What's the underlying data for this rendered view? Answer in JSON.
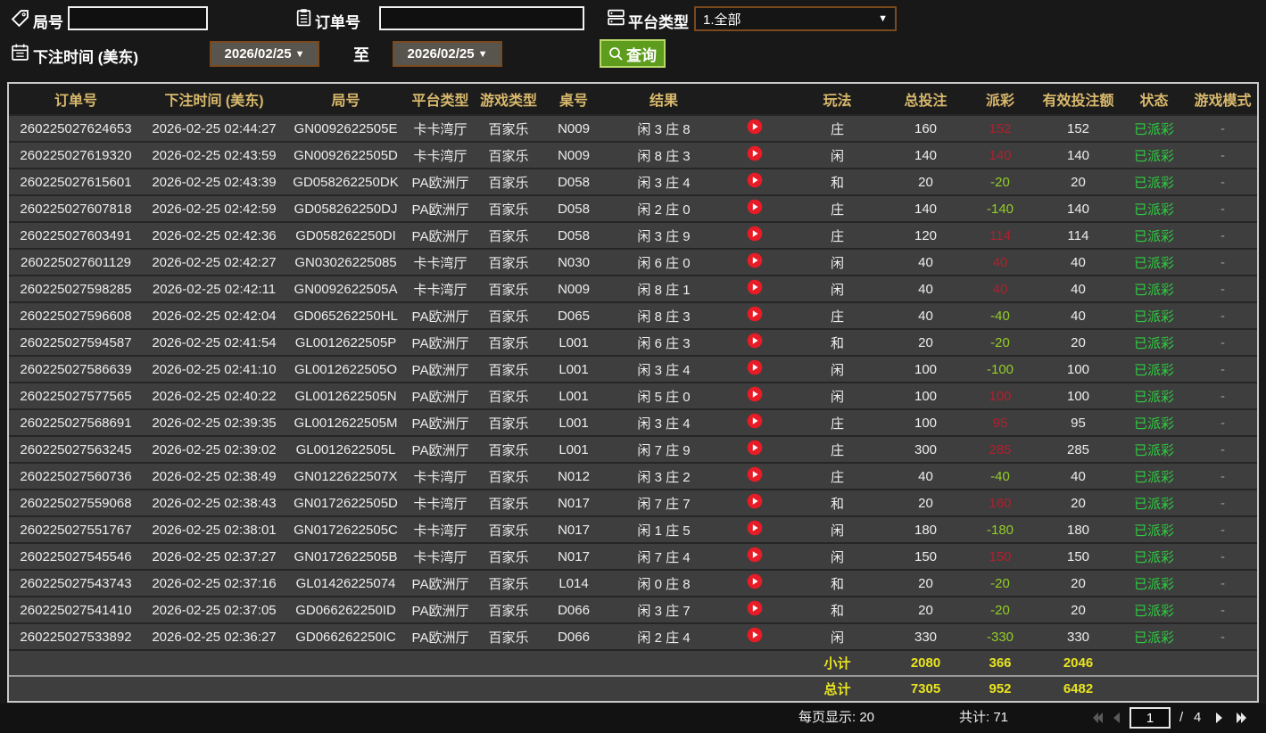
{
  "filters": {
    "round_label": "局号",
    "order_label": "订单号",
    "platform_label": "平台类型",
    "platform_value": "1.全部",
    "bet_time_label": "下注时间 (美东)",
    "date_from": "2026/02/25",
    "date_to": "2026/02/25",
    "to_label": "至",
    "query_label": "查询",
    "round_value": "",
    "order_value": ""
  },
  "table": {
    "headers": [
      "订单号",
      "下注时间 (美东)",
      "局号",
      "平台类型",
      "游戏类型",
      "桌号",
      "结果",
      "",
      "玩法",
      "总投注",
      "派彩",
      "有效投注额",
      "状态",
      "游戏模式"
    ],
    "rows": [
      {
        "order": "260225027624653",
        "time": "2026-02-25 02:44:27",
        "round": "GN0092622505E",
        "platform": "卡卡湾厅",
        "game": "百家乐",
        "table": "N009",
        "result": "闲 3 庄 8",
        "play": "庄",
        "total": "160",
        "payout": "152",
        "sign": "pos",
        "valid": "152",
        "status": "已派彩",
        "mode": "-"
      },
      {
        "order": "260225027619320",
        "time": "2026-02-25 02:43:59",
        "round": "GN0092622505D",
        "platform": "卡卡湾厅",
        "game": "百家乐",
        "table": "N009",
        "result": "闲 8 庄 3",
        "play": "闲",
        "total": "140",
        "payout": "140",
        "sign": "pos",
        "valid": "140",
        "status": "已派彩",
        "mode": "-"
      },
      {
        "order": "260225027615601",
        "time": "2026-02-25 02:43:39",
        "round": "GD058262250DK",
        "platform": "PA欧洲厅",
        "game": "百家乐",
        "table": "D058",
        "result": "闲 3 庄 4",
        "play": "和",
        "total": "20",
        "payout": "-20",
        "sign": "neg",
        "valid": "20",
        "status": "已派彩",
        "mode": "-"
      },
      {
        "order": "260225027607818",
        "time": "2026-02-25 02:42:59",
        "round": "GD058262250DJ",
        "platform": "PA欧洲厅",
        "game": "百家乐",
        "table": "D058",
        "result": "闲 2 庄 0",
        "play": "庄",
        "total": "140",
        "payout": "-140",
        "sign": "neg",
        "valid": "140",
        "status": "已派彩",
        "mode": "-"
      },
      {
        "order": "260225027603491",
        "time": "2026-02-25 02:42:36",
        "round": "GD058262250DI",
        "platform": "PA欧洲厅",
        "game": "百家乐",
        "table": "D058",
        "result": "闲 3 庄 9",
        "play": "庄",
        "total": "120",
        "payout": "114",
        "sign": "pos",
        "valid": "114",
        "status": "已派彩",
        "mode": "-"
      },
      {
        "order": "260225027601129",
        "time": "2026-02-25 02:42:27",
        "round": "GN03026225085",
        "platform": "卡卡湾厅",
        "game": "百家乐",
        "table": "N030",
        "result": "闲 6 庄 0",
        "play": "闲",
        "total": "40",
        "payout": "40",
        "sign": "pos",
        "valid": "40",
        "status": "已派彩",
        "mode": "-"
      },
      {
        "order": "260225027598285",
        "time": "2026-02-25 02:42:11",
        "round": "GN0092622505A",
        "platform": "卡卡湾厅",
        "game": "百家乐",
        "table": "N009",
        "result": "闲 8 庄 1",
        "play": "闲",
        "total": "40",
        "payout": "40",
        "sign": "pos",
        "valid": "40",
        "status": "已派彩",
        "mode": "-"
      },
      {
        "order": "260225027596608",
        "time": "2026-02-25 02:42:04",
        "round": "GD065262250HL",
        "platform": "PA欧洲厅",
        "game": "百家乐",
        "table": "D065",
        "result": "闲 8 庄 3",
        "play": "庄",
        "total": "40",
        "payout": "-40",
        "sign": "neg",
        "valid": "40",
        "status": "已派彩",
        "mode": "-"
      },
      {
        "order": "260225027594587",
        "time": "2026-02-25 02:41:54",
        "round": "GL0012622505P",
        "platform": "PA欧洲厅",
        "game": "百家乐",
        "table": "L001",
        "result": "闲 6 庄 3",
        "play": "和",
        "total": "20",
        "payout": "-20",
        "sign": "neg",
        "valid": "20",
        "status": "已派彩",
        "mode": "-"
      },
      {
        "order": "260225027586639",
        "time": "2026-02-25 02:41:10",
        "round": "GL0012622505O",
        "platform": "PA欧洲厅",
        "game": "百家乐",
        "table": "L001",
        "result": "闲 3 庄 4",
        "play": "闲",
        "total": "100",
        "payout": "-100",
        "sign": "neg",
        "valid": "100",
        "status": "已派彩",
        "mode": "-"
      },
      {
        "order": "260225027577565",
        "time": "2026-02-25 02:40:22",
        "round": "GL0012622505N",
        "platform": "PA欧洲厅",
        "game": "百家乐",
        "table": "L001",
        "result": "闲 5 庄 0",
        "play": "闲",
        "total": "100",
        "payout": "100",
        "sign": "pos",
        "valid": "100",
        "status": "已派彩",
        "mode": "-"
      },
      {
        "order": "260225027568691",
        "time": "2026-02-25 02:39:35",
        "round": "GL0012622505M",
        "platform": "PA欧洲厅",
        "game": "百家乐",
        "table": "L001",
        "result": "闲 3 庄 4",
        "play": "庄",
        "total": "100",
        "payout": "95",
        "sign": "pos",
        "valid": "95",
        "status": "已派彩",
        "mode": "-"
      },
      {
        "order": "260225027563245",
        "time": "2026-02-25 02:39:02",
        "round": "GL0012622505L",
        "platform": "PA欧洲厅",
        "game": "百家乐",
        "table": "L001",
        "result": "闲 7 庄 9",
        "play": "庄",
        "total": "300",
        "payout": "285",
        "sign": "pos",
        "valid": "285",
        "status": "已派彩",
        "mode": "-"
      },
      {
        "order": "260225027560736",
        "time": "2026-02-25 02:38:49",
        "round": "GN0122622507X",
        "platform": "卡卡湾厅",
        "game": "百家乐",
        "table": "N012",
        "result": "闲 3 庄 2",
        "play": "庄",
        "total": "40",
        "payout": "-40",
        "sign": "neg",
        "valid": "40",
        "status": "已派彩",
        "mode": "-"
      },
      {
        "order": "260225027559068",
        "time": "2026-02-25 02:38:43",
        "round": "GN0172622505D",
        "platform": "卡卡湾厅",
        "game": "百家乐",
        "table": "N017",
        "result": "闲 7 庄 7",
        "play": "和",
        "total": "20",
        "payout": "160",
        "sign": "pos",
        "valid": "20",
        "status": "已派彩",
        "mode": "-"
      },
      {
        "order": "260225027551767",
        "time": "2026-02-25 02:38:01",
        "round": "GN0172622505C",
        "platform": "卡卡湾厅",
        "game": "百家乐",
        "table": "N017",
        "result": "闲 1 庄 5",
        "play": "闲",
        "total": "180",
        "payout": "-180",
        "sign": "neg",
        "valid": "180",
        "status": "已派彩",
        "mode": "-"
      },
      {
        "order": "260225027545546",
        "time": "2026-02-25 02:37:27",
        "round": "GN0172622505B",
        "platform": "卡卡湾厅",
        "game": "百家乐",
        "table": "N017",
        "result": "闲 7 庄 4",
        "play": "闲",
        "total": "150",
        "payout": "150",
        "sign": "pos",
        "valid": "150",
        "status": "已派彩",
        "mode": "-"
      },
      {
        "order": "260225027543743",
        "time": "2026-02-25 02:37:16",
        "round": "GL01426225074",
        "platform": "PA欧洲厅",
        "game": "百家乐",
        "table": "L014",
        "result": "闲 0 庄 8",
        "play": "和",
        "total": "20",
        "payout": "-20",
        "sign": "neg",
        "valid": "20",
        "status": "已派彩",
        "mode": "-"
      },
      {
        "order": "260225027541410",
        "time": "2026-02-25 02:37:05",
        "round": "GD066262250ID",
        "platform": "PA欧洲厅",
        "game": "百家乐",
        "table": "D066",
        "result": "闲 3 庄 7",
        "play": "和",
        "total": "20",
        "payout": "-20",
        "sign": "neg",
        "valid": "20",
        "status": "已派彩",
        "mode": "-"
      },
      {
        "order": "260225027533892",
        "time": "2026-02-25 02:36:27",
        "round": "GD066262250IC",
        "platform": "PA欧洲厅",
        "game": "百家乐",
        "table": "D066",
        "result": "闲 2 庄 4",
        "play": "闲",
        "total": "330",
        "payout": "-330",
        "sign": "neg",
        "valid": "330",
        "status": "已派彩",
        "mode": "-"
      }
    ],
    "subtotal": {
      "label": "小计",
      "total": "2080",
      "payout": "366",
      "valid": "2046"
    },
    "grandtotal": {
      "label": "总计",
      "total": "7305",
      "payout": "952",
      "valid": "6482"
    }
  },
  "footer": {
    "per_page_label": "每页显示: 20",
    "total_count_label": "共计: 71",
    "page_value": "1",
    "page_sep": "/",
    "total_pages": "4"
  },
  "colors": {
    "header_text": "#d9b96c",
    "payout_positive": "#b1202e",
    "payout_negative": "#93cd28",
    "status_paid": "#2ecc40",
    "totals_yellow": "#e8e41f",
    "query_button_green": "#5d9c1c",
    "picker_border_brown": "#7a4a1e",
    "replay_red": "#e81c26"
  }
}
